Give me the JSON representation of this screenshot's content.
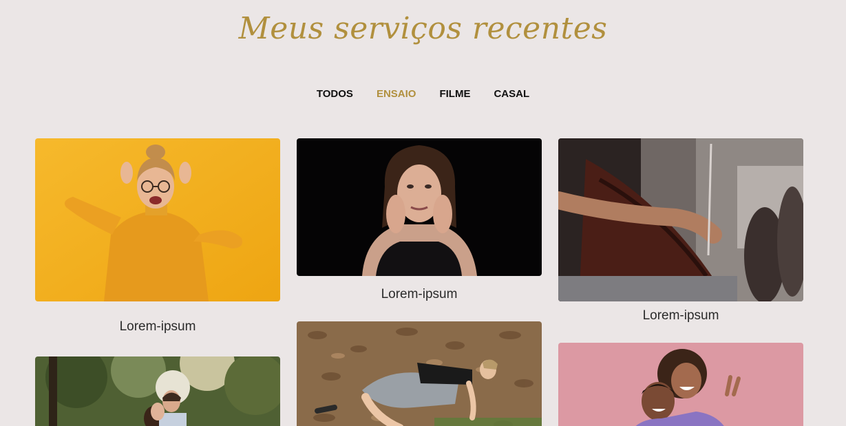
{
  "title": "Meus serviços recentes",
  "filters": [
    {
      "label": "TODOS",
      "active": false
    },
    {
      "label": "ENSAIO",
      "active": true
    },
    {
      "label": "FILME",
      "active": false
    },
    {
      "label": "CASAL",
      "active": false
    }
  ],
  "accent_color": "#b1903e",
  "portfolio": [
    {
      "caption": "Lorem-ipsum",
      "image": "woman-yellow-sweater-photo"
    },
    {
      "caption": "Lorem-ipsum",
      "image": "woman-hands-on-face-photo"
    },
    {
      "caption": "Lorem-ipsum",
      "image": "cellist-playing-photo"
    },
    {
      "caption": "",
      "image": "couple-forest-photo"
    },
    {
      "caption": "",
      "image": "woman-lying-on-leaves-photo"
    },
    {
      "caption": "",
      "image": "couple-pink-background-photo"
    }
  ]
}
